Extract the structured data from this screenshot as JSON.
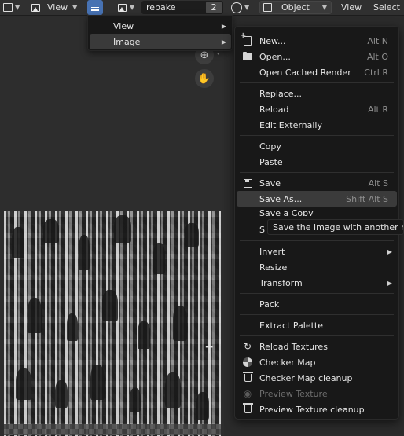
{
  "header": {
    "view_label": "View",
    "image_name": "rebake",
    "user_count": "2",
    "object_mode": "Object",
    "view_menu": "View",
    "select_menu": "Select"
  },
  "image_menu_parent": {
    "items": [
      {
        "label": "View"
      },
      {
        "label": "Image"
      }
    ]
  },
  "image_menu": {
    "items": [
      {
        "label": "New...",
        "shortcut": "Alt N"
      },
      {
        "label": "Open...",
        "shortcut": "Alt O"
      },
      {
        "label": "Open Cached Render",
        "shortcut": "Ctrl R"
      },
      {
        "label": "Replace...",
        "shortcut": ""
      },
      {
        "label": "Reload",
        "shortcut": "Alt R"
      },
      {
        "label": "Edit Externally",
        "shortcut": ""
      },
      {
        "label": "Copy",
        "shortcut": ""
      },
      {
        "label": "Paste",
        "shortcut": ""
      },
      {
        "label": "Save",
        "shortcut": "Alt S"
      },
      {
        "label": "Save As...",
        "shortcut": "Shift Alt S"
      },
      {
        "label": "Save a Copy",
        "shortcut": ""
      },
      {
        "label": "S",
        "shortcut": ""
      },
      {
        "label": "Invert",
        "shortcut": ""
      },
      {
        "label": "Resize",
        "shortcut": ""
      },
      {
        "label": "Transform",
        "shortcut": ""
      },
      {
        "label": "Pack",
        "shortcut": ""
      },
      {
        "label": "Extract Palette",
        "shortcut": ""
      },
      {
        "label": "Reload Textures",
        "shortcut": ""
      },
      {
        "label": "Checker Map",
        "shortcut": ""
      },
      {
        "label": "Checker Map cleanup",
        "shortcut": ""
      },
      {
        "label": "Preview Texture",
        "shortcut": ""
      },
      {
        "label": "Preview Texture cleanup",
        "shortcut": ""
      }
    ]
  },
  "tooltip": {
    "text": "Save the image with another nar"
  },
  "colors": {
    "accent": "#4772b3",
    "menu_bg": "#181818",
    "highlight": "#3b3b3b"
  }
}
